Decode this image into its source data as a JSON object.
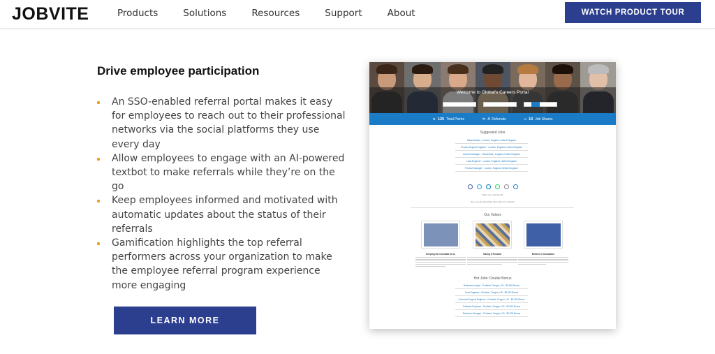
{
  "nav": {
    "logo": "JOBVITE",
    "items": [
      "Products",
      "Solutions",
      "Resources",
      "Support",
      "About"
    ],
    "cta": "WATCH PRODUCT TOUR"
  },
  "section": {
    "heading": "Drive employee participation",
    "bullets": [
      "An SSO-enabled referral portal makes it easy for employees to reach out to their professional networks via the social platforms they use every day",
      "Allow employees to engage with an AI-powered textbot to make referrals while they’re on the go",
      "Keep employees informed and motivated with automatic updates about the status of their referrals",
      "Gamification highlights the top referral performers across your organization to make the employee referral program experience more engaging"
    ],
    "cta": "LEARN MORE"
  },
  "mockup": {
    "hero_title": "Welcome to Global's Careers Portal",
    "stats": [
      {
        "icon": "star-icon",
        "value": "125",
        "label": "Total Points"
      },
      {
        "icon": "share-icon",
        "value": "4",
        "label": "Referrals"
      },
      {
        "icon": "link-icon",
        "value": "13",
        "label": "Job Shares"
      }
    ],
    "suggested_title": "Suggested Jobs",
    "suggested_jobs": [
      "Sales Analyst · London, England, United Kingdom",
      "Product Support Engineer · London, England, United Kingdom",
      "Account Manager · Manchester, England, United Kingdom",
      "Lead Engineer · London, England, United Kingdom",
      "Product Manager · London, England, United Kingdom"
    ],
    "share_note": "Share your referral link",
    "link_note": "See our jobs and share them with your network",
    "values_title": "Our Values",
    "values": [
      {
        "name": "Keeping the end-state of us",
        "color": "#7d92b8"
      },
      {
        "name": "Taking it Forward",
        "color": "#c9a35c"
      },
      {
        "name": "Believe in Innovation",
        "color": "#3f5fa6"
      }
    ],
    "hot_title": "Hot Jobs: Double Bonus",
    "hot_jobs": [
      "Business Analyst · Portland, Oregon, US · $2,000 Bonus",
      "Lead Engineer · Portland, Oregon, US · $2,000 Bonus",
      "Technical Support Engineer · Portland, Oregon, US · $2,000 Bonus",
      "Software Engineer · Portland, Oregon, US · $2,000 Bonus",
      "Business Manager · Portland, Oregon, US · $2,000 Bonus"
    ]
  },
  "colors": {
    "brand_blue": "#2c3f8f",
    "bullet_orange": "#f0a020",
    "portal_blue": "#1a7bc6"
  }
}
